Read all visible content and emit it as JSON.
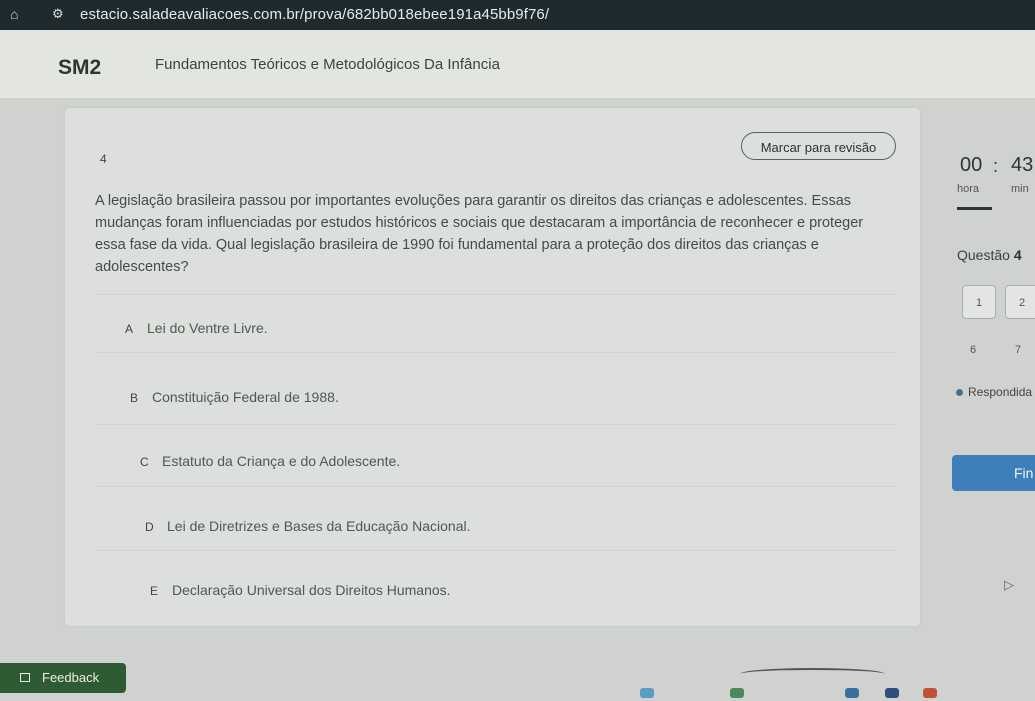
{
  "browser": {
    "url": "estacio.saladeavaliacoes.com.br/prova/682bb018ebee191a45bb9f76/"
  },
  "header": {
    "code": "SM2",
    "course": "Fundamentos Teóricos e Metodológicos Da Infância"
  },
  "question": {
    "number": "4",
    "review_label": "Marcar para revisão",
    "text": "A legislação brasileira passou por importantes evoluções para garantir os direitos das crianças e adolescentes. Essas mudanças foram influenciadas por estudos históricos e sociais que destacaram a importância de reconhecer e proteger essa fase da vida. Qual legislação brasileira de 1990 foi fundamental para a proteção dos direitos das crianças e adolescentes?",
    "options": [
      {
        "letter": "A",
        "text": "Lei do Ventre Livre."
      },
      {
        "letter": "B",
        "text": "Constituição Federal de 1988."
      },
      {
        "letter": "C",
        "text": "Estatuto da Criança e do Adolescente."
      },
      {
        "letter": "D",
        "text": "Lei de Diretrizes e Bases da Educação Nacional."
      },
      {
        "letter": "E",
        "text": "Declaração Universal dos Direitos Humanos."
      }
    ]
  },
  "timer": {
    "hours": "00",
    "separator": ":",
    "minutes": "43",
    "hours_label": "hora",
    "minutes_label": "min"
  },
  "sidebar": {
    "question_label": "Questão",
    "question_current": "4",
    "question_boxes": [
      "1",
      "2"
    ],
    "question_labels": [
      "6",
      "7"
    ],
    "legend_answered": "Respondida",
    "finish_label": "Fin"
  },
  "feedback": {
    "label": "Feedback"
  },
  "colors": {
    "accent_blue": "#3d7fb9",
    "feedback_green": "#2f5b34",
    "addressbar": "#1f2a2e"
  }
}
